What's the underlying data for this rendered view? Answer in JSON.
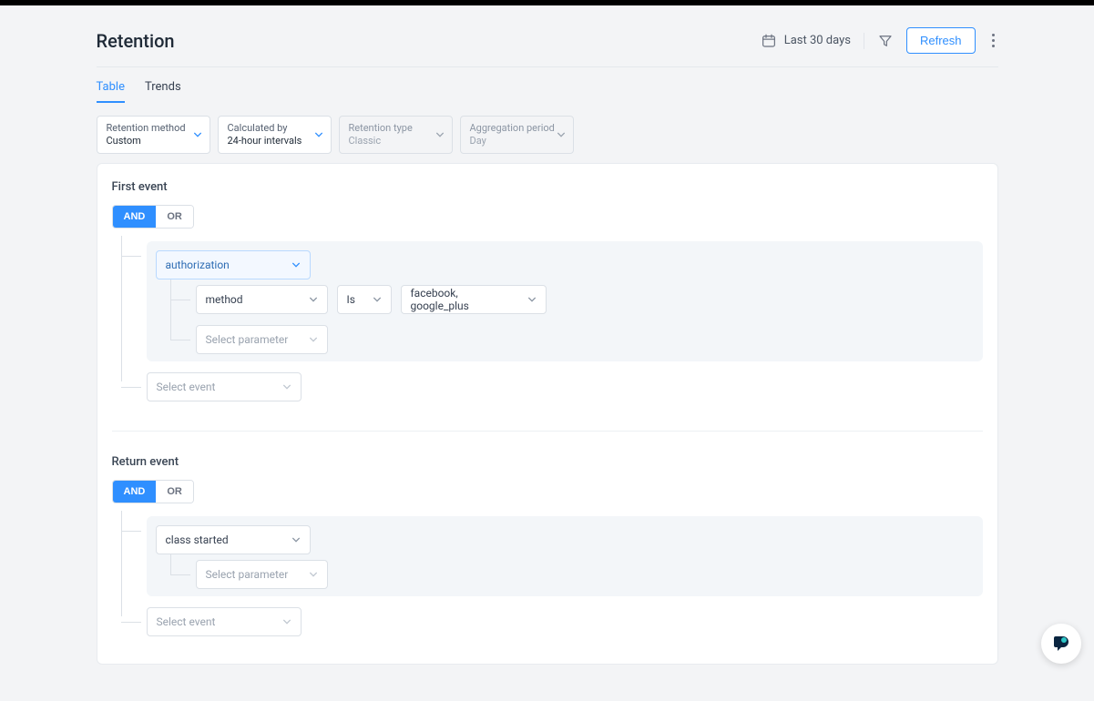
{
  "header": {
    "title": "Retention",
    "date_range": "Last 30 days",
    "refresh": "Refresh"
  },
  "tabs": {
    "table": "Table",
    "trends": "Trends",
    "active": "table"
  },
  "selectors": {
    "retention_method": {
      "label": "Retention method",
      "value": "Custom",
      "disabled": false
    },
    "calculated_by": {
      "label": "Calculated by",
      "value": "24-hour intervals",
      "disabled": false
    },
    "retention_type": {
      "label": "Retention type",
      "value": "Classic",
      "disabled": true
    },
    "aggregation": {
      "label": "Aggregation period",
      "value": "Day",
      "disabled": true
    }
  },
  "first_event": {
    "title": "First event",
    "logic": {
      "and": "AND",
      "or": "OR",
      "active": "and"
    },
    "event": "authorization",
    "param_rows": [
      {
        "param": "method",
        "op": "Is",
        "value": "facebook, google_plus"
      }
    ],
    "select_parameter": "Select parameter",
    "select_event": "Select event"
  },
  "return_event": {
    "title": "Return event",
    "logic": {
      "and": "AND",
      "or": "OR",
      "active": "and"
    },
    "event": "class started",
    "select_parameter": "Select parameter",
    "select_event": "Select event"
  }
}
